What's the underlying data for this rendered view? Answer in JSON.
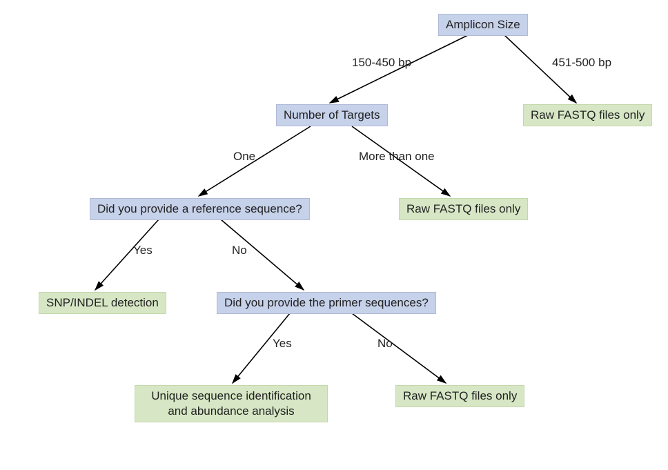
{
  "nodes": {
    "amplicon_size": "Amplicon Size",
    "num_targets": "Number of Targets",
    "ref_seq": "Did you provide a reference sequence?",
    "primer_seq": "Did you provide the primer sequences?",
    "fastq_1": "Raw FASTQ files only",
    "fastq_2": "Raw FASTQ files only",
    "fastq_3": "Raw FASTQ files only",
    "snp_indel": "SNP/INDEL detection",
    "unique_seq": "Unique sequence identification\nand abundance analysis"
  },
  "labels": {
    "bp_150_450": "150-450 bp",
    "bp_451_500": "451-500 bp",
    "one": "One",
    "more_than_one": "More than one",
    "yes1": "Yes",
    "no1": "No",
    "yes2": "Yes",
    "no2": "No"
  }
}
